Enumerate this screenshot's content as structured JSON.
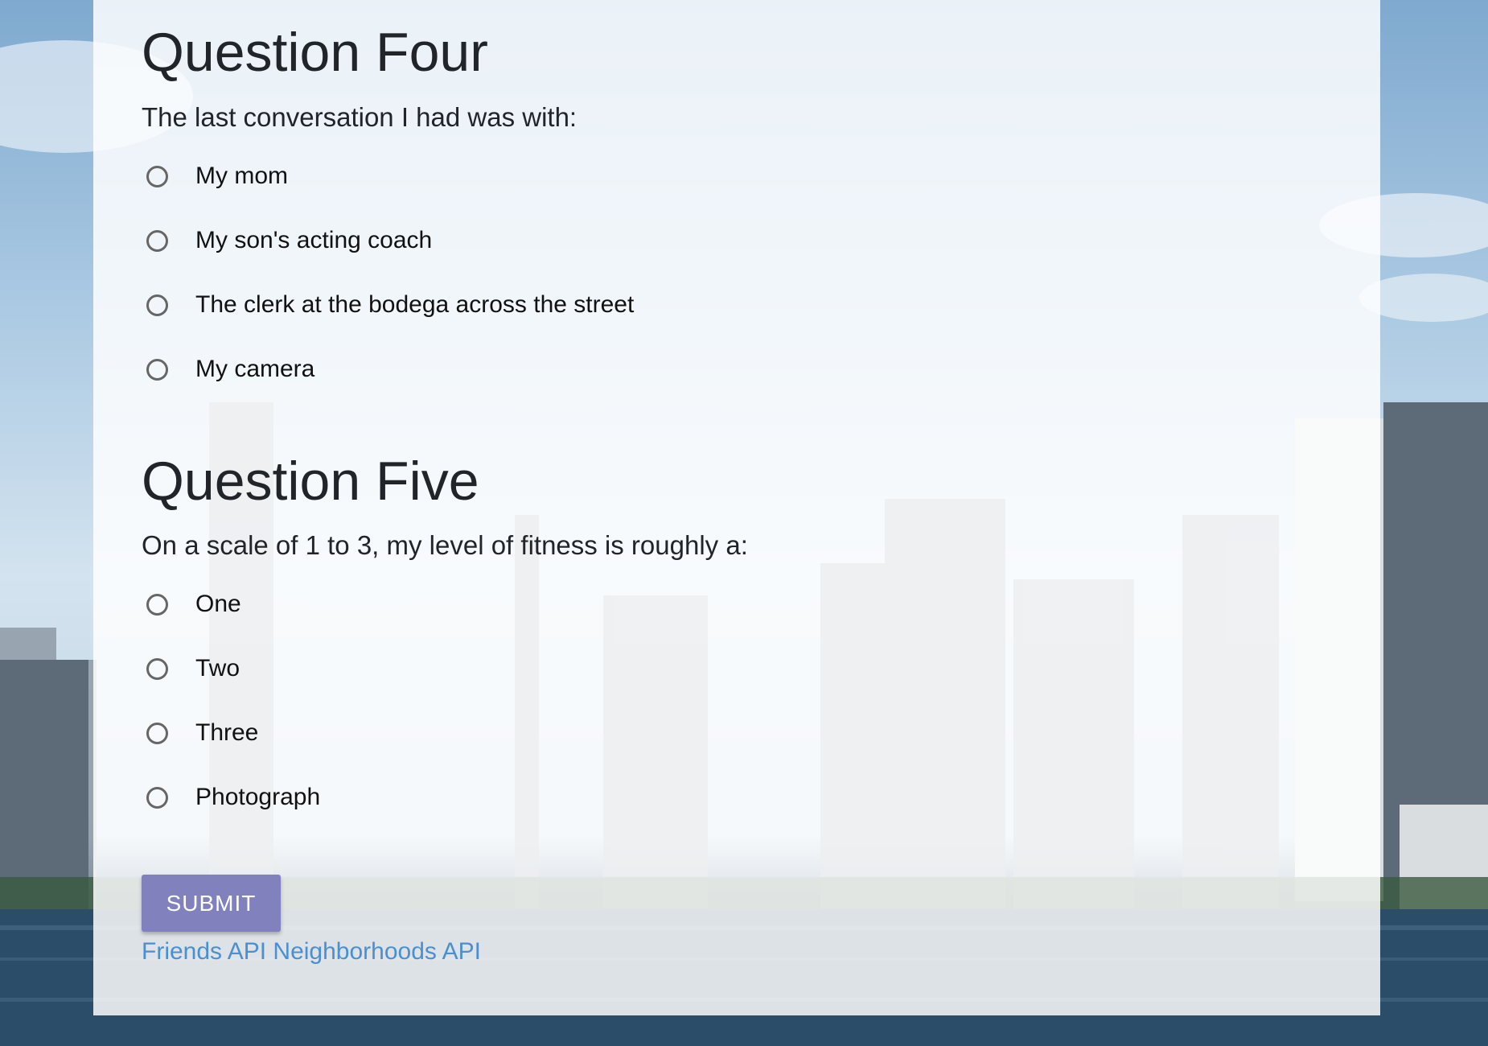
{
  "question_four": {
    "title": "Question Four",
    "prompt": "The last conversation I had was with:",
    "options": [
      "My mom",
      "My son's acting coach",
      "The clerk at the bodega across the street",
      "My camera"
    ]
  },
  "question_five": {
    "title": "Question Five",
    "prompt": "On a scale of 1 to 3, my level of fitness is roughly a:",
    "options": [
      "One",
      "Two",
      "Three",
      "Photograph"
    ]
  },
  "form": {
    "submit_label": "SUBMIT"
  },
  "footer_links": {
    "friends": "Friends API",
    "neighborhoods": "Neighborhoods API"
  },
  "colors": {
    "submit_bg": "#8081bd",
    "link": "#4b8fd1"
  }
}
